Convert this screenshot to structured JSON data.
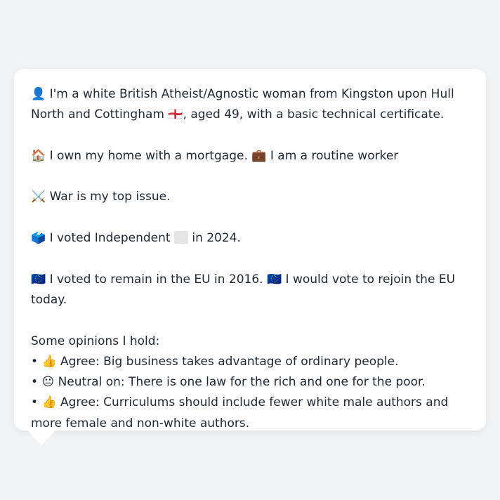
{
  "persona": {
    "identity": {
      "icon": "👤",
      "text_1": "I'm a white British Atheist/Agnostic woman from Kingston upon Hull North and Cottingham",
      "flag": "🏴󠁧󠁢󠁥󠁮󠁧󠁿",
      "text_2": ", aged 49, with a basic technical certificate."
    },
    "housing": {
      "home_icon": "🏠",
      "home_text": "I own my home with a mortgage.",
      "work_icon": "💼",
      "work_text": "I am a routine worker"
    },
    "issue": {
      "icon": "⚔️",
      "text": "War is my top issue."
    },
    "vote": {
      "icon": "🗳️",
      "text_1": "I voted Independent",
      "party_icon": "grey-square-icon",
      "text_2": "in 2024."
    },
    "eu": {
      "icon": "🇪🇺",
      "text_1": "I voted to remain in the EU in 2016.",
      "icon_2": "🇪🇺",
      "text_2": "I would vote to rejoin the EU today."
    },
    "opinions": {
      "heading": "Some opinions I hold:",
      "bullet": "•",
      "items": [
        {
          "icon": "👍",
          "text": "Agree: Big business takes advantage of ordinary people."
        },
        {
          "icon": "😐",
          "text": "Neutral on: There is one law for the rich and one for the poor."
        },
        {
          "icon": "👍",
          "text": "Agree: Curriculums should include fewer white male authors and more female and non-white authors."
        }
      ]
    }
  }
}
